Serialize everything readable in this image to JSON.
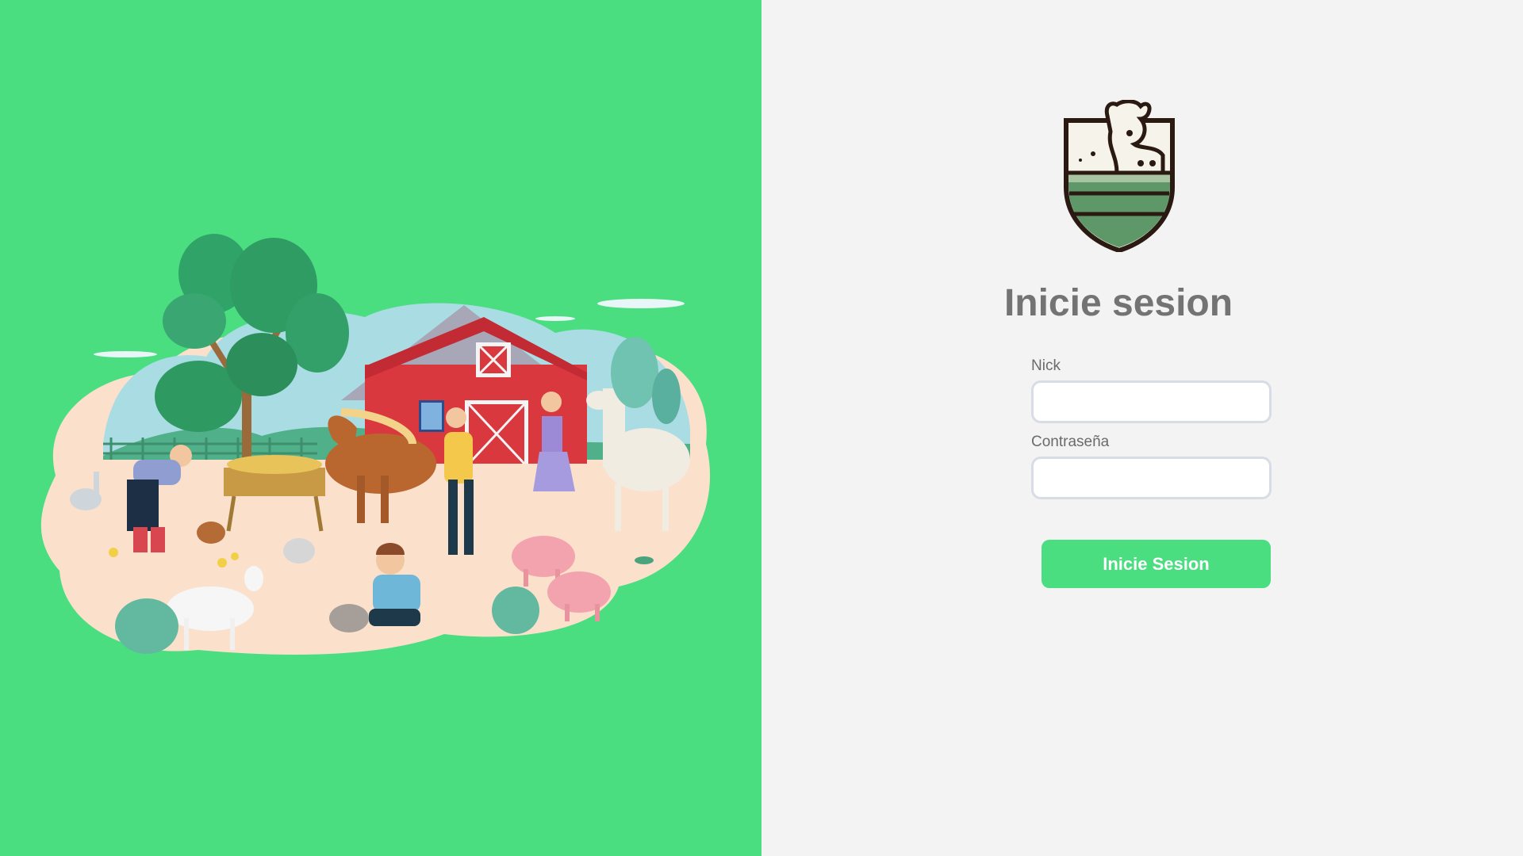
{
  "illustration": {
    "name": "farm-scene-illustration",
    "background_color": "#4ade80"
  },
  "logo": {
    "icon": "cow-shield-logo-icon"
  },
  "login": {
    "title": "Inicie sesion",
    "nick_label": "Nick",
    "nick_value": "",
    "password_label": "Contraseña",
    "password_value": "",
    "submit_label": "Inicie Sesion"
  },
  "colors": {
    "accent": "#4ade80",
    "panel_bg": "#f3f3f3",
    "title_color": "#737373",
    "input_border": "#d7dce5"
  }
}
